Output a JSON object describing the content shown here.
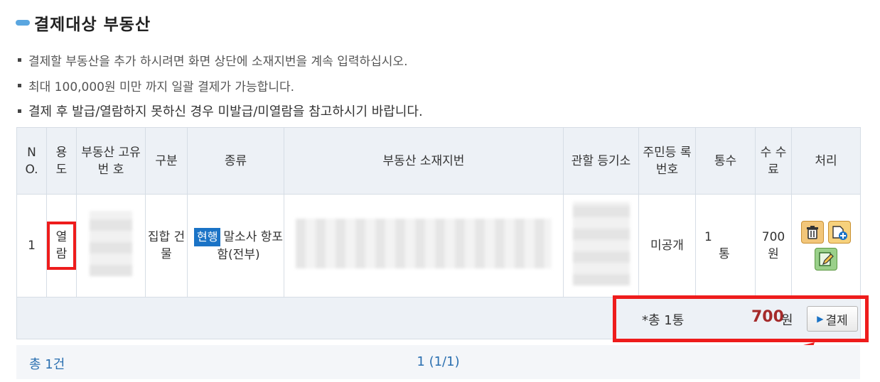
{
  "section": {
    "title": "결제대상 부동산"
  },
  "notes": [
    "결제할 부동산을 추가 하시려면 화면 상단에 소재지번을 계속 입력하십시오.",
    "최대 100,000원 미만 까지 일괄 결제가 가능합니다.",
    "결제 후 발급/열람하지 못하신 경우 미발급/미열람을 참고하시기 바랍니다."
  ],
  "table": {
    "headers": {
      "no": "N O.",
      "usage": "용 도",
      "unique_no": "부동산 고유번 호",
      "category": "구분",
      "kind": "종류",
      "address": "부동산 소재지번",
      "registry": "관할 등기소",
      "resident_no": "주민등 록번호",
      "count": "통수",
      "fee": "수 수 료",
      "action": "처리"
    },
    "row": {
      "no": "1",
      "usage": "열 람",
      "category": "집합 건물",
      "kind_badge": "현행",
      "kind_text": "말소사 항포함(전부)",
      "resident_no": "미공개",
      "count_value": "1",
      "count_unit": "통",
      "fee": "700 원",
      "icons": [
        "trash-icon",
        "add-document-icon",
        "edit-icon"
      ]
    }
  },
  "totals": {
    "label": "*총 1통",
    "amount": "700",
    "unit": "원",
    "pay_button": "결제"
  },
  "pager": {
    "count": "총 1건",
    "pages": "1 (1/1)"
  },
  "colors": {
    "highlight": "#ee1c1c",
    "badge": "#1a73c6",
    "amount": "#a52a2a"
  }
}
